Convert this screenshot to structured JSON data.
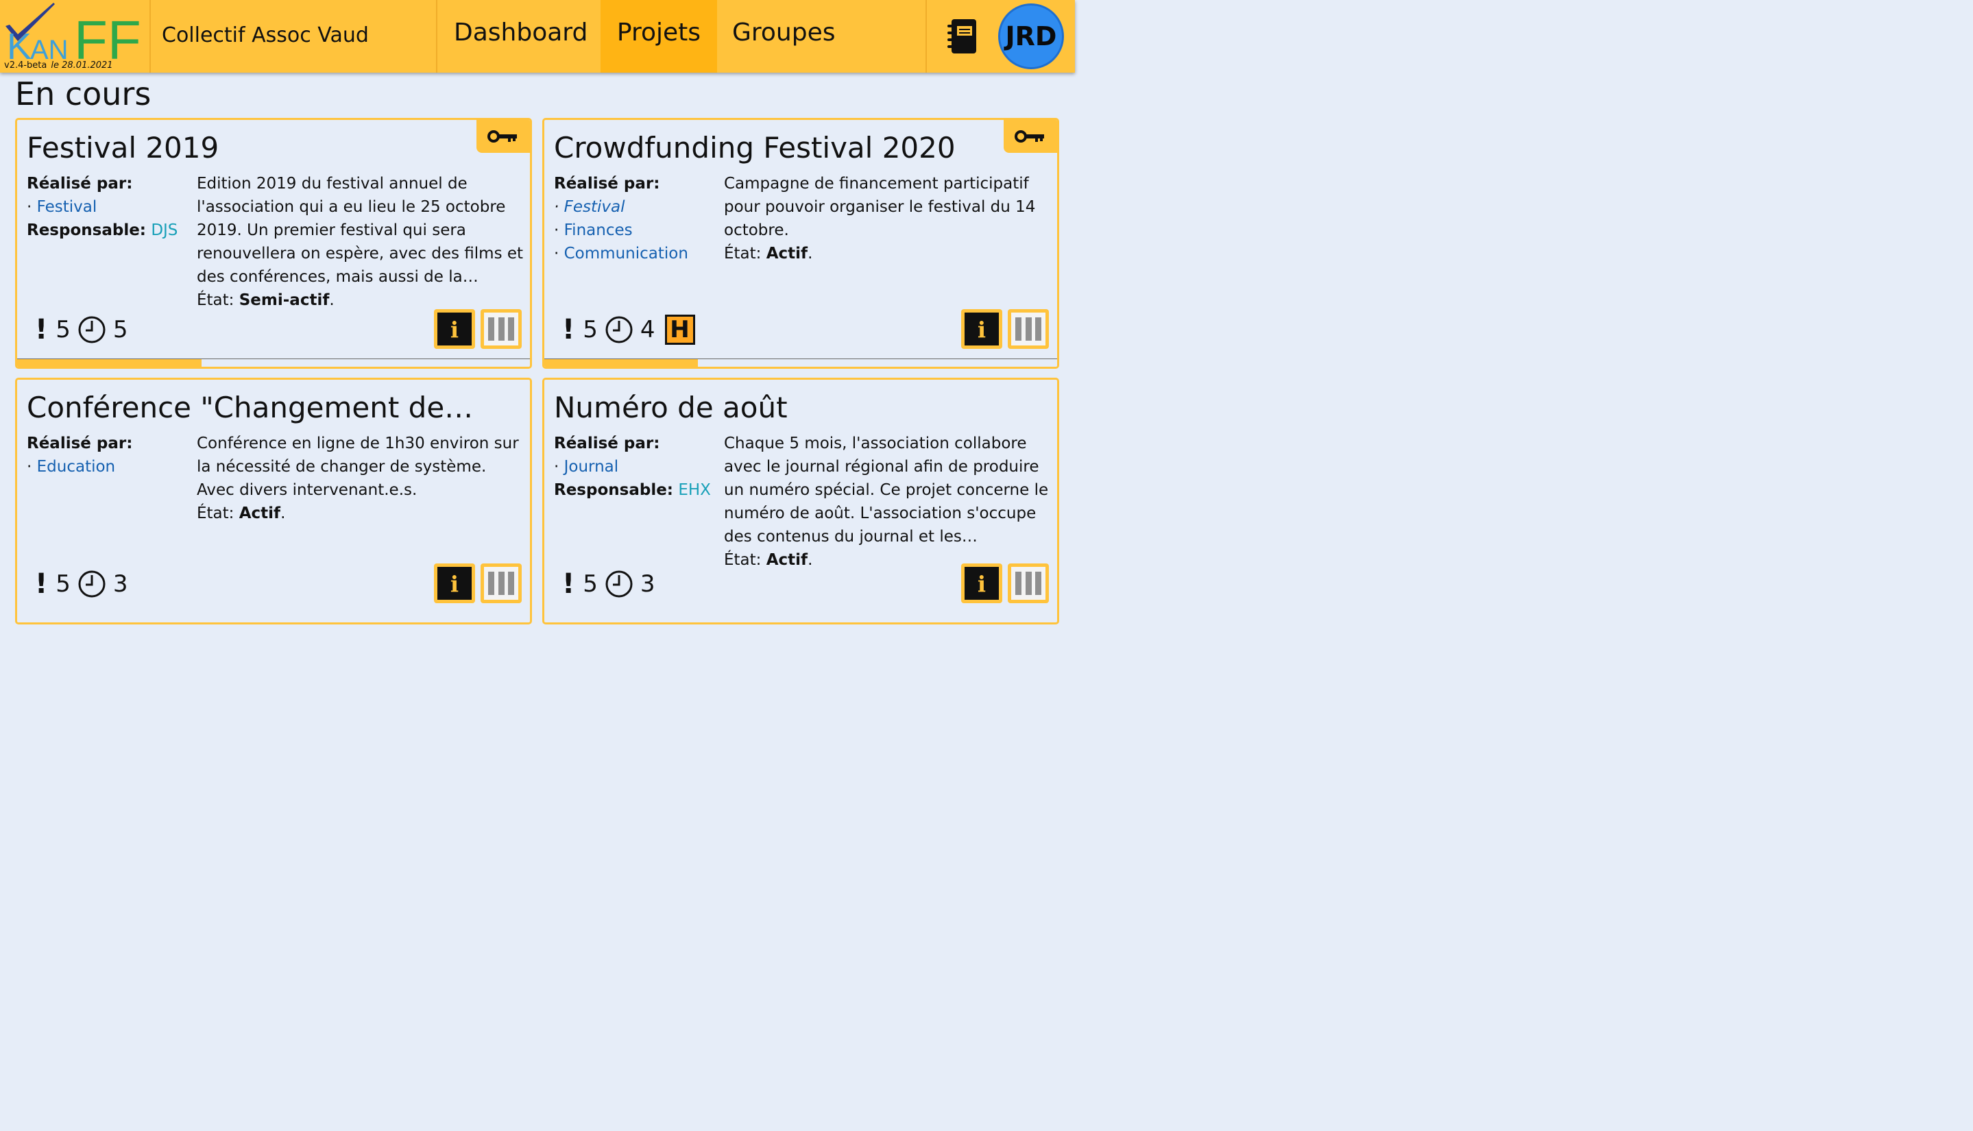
{
  "app": {
    "logo_text": "KanFF",
    "version": "v2.4-beta",
    "date": "le 28.01.2021",
    "org_name": "Collectif Assoc Vaud",
    "user_initials": "JRD"
  },
  "nav": [
    {
      "label": "Dashboard",
      "active": false
    },
    {
      "label": "Projets",
      "active": true
    },
    {
      "label": "Groupes",
      "active": false
    }
  ],
  "section_title": "En cours",
  "labels": {
    "realise_par": "Réalisé par:",
    "responsable": "Responsable:",
    "etat": "État:",
    "bullet": "·",
    "exclamation": "!",
    "info_icon_label": "i",
    "h_badge": "H"
  },
  "colors": {
    "header": "#ffc33c",
    "active_nav": "#ffb414",
    "background": "#e6edf8",
    "link": "#1560b0",
    "responsable": "#18a0b8",
    "avatar": "#2f8cf0"
  },
  "projects": [
    {
      "title": "Festival 2019",
      "key_icon": true,
      "teams": [
        "Festival"
      ],
      "responsable": "DJS",
      "description": "Edition 2019 du festival annuel de l'association qui a eu lieu le 25 octobre 2019. Un premier festival qui sera renouvellera on espère, avec des films et des conférences, mais aussi de la…",
      "state": "Semi-actif",
      "important": "5",
      "urgent": "5",
      "progress": 0.36
    },
    {
      "title": "Crowdfunding Festival 2020",
      "key_icon": true,
      "teams": [
        "Festival",
        "Finances",
        "Communication"
      ],
      "description": "Campagne de financement participatif pour pouvoir organiser le festival du 14 octobre.",
      "state": "Actif",
      "important": "5",
      "urgent": "4",
      "h_badge": true,
      "progress": 0.3
    },
    {
      "title": "Conférence \"Changement de…",
      "teams": [
        "Education"
      ],
      "description": "Conférence en ligne de 1h30 environ sur la nécessité de changer de système. Avec divers intervenant.e.s.",
      "state": "Actif",
      "important": "5",
      "urgent": "3"
    },
    {
      "title": "Numéro de août",
      "teams": [
        "Journal"
      ],
      "responsable": "EHX",
      "description": "Chaque 5 mois, l'association collabore avec le journal régional afin de produire un numéro spécial. Ce projet concerne le numéro de août. L'association s'occupe des contenus du journal et les…",
      "state": "Actif",
      "important": "5",
      "urgent": "3"
    }
  ]
}
